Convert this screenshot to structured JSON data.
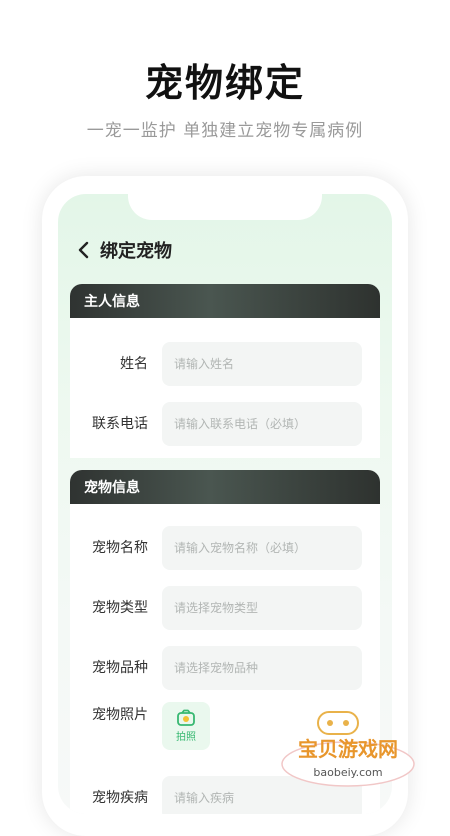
{
  "header": {
    "headline": "宠物绑定",
    "subline": "一宠一监护 单独建立宠物专属病例"
  },
  "app": {
    "title": "绑定宠物"
  },
  "sections": {
    "owner": {
      "title": "主人信息",
      "fields": [
        {
          "label": "姓名",
          "placeholder": "请输入姓名"
        },
        {
          "label": "联系电话",
          "placeholder": "请输入联系电话（必填）"
        }
      ]
    },
    "pet": {
      "title": "宠物信息",
      "fields": [
        {
          "label": "宠物名称",
          "placeholder": "请输入宠物名称（必填）"
        },
        {
          "label": "宠物类型",
          "placeholder": "请选择宠物类型"
        },
        {
          "label": "宠物品种",
          "placeholder": "请选择宠物品种"
        }
      ],
      "photo": {
        "label": "宠物照片",
        "button": "拍照"
      },
      "disease": {
        "label": "宠物疾病",
        "placeholder": "请输入疾病"
      }
    }
  },
  "watermark": {
    "text": "宝贝游戏网",
    "url": "baobeiy.com"
  },
  "colors": {
    "accent": "#37b871",
    "section_bar": "#2f3331"
  }
}
